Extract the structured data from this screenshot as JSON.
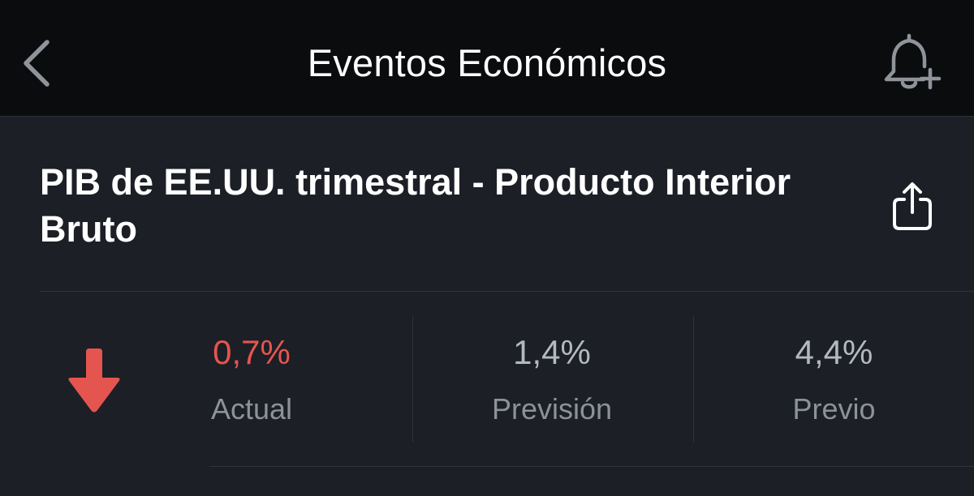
{
  "colors": {
    "nav_background": "#0b0c0e",
    "page_background": "#1c1f26",
    "negative": "#e5554f",
    "text_primary": "#ffffff",
    "text_secondary": "#8d9199"
  },
  "nav": {
    "back_icon": "chevron-left-icon",
    "title": "Eventos Económicos",
    "alert_icon": "bell-plus-icon"
  },
  "event": {
    "title": "PIB de EE.UU. trimestral - Producto Interior Bruto",
    "share_icon": "share-icon",
    "trend_icon": "arrow-down-icon",
    "trend": "down"
  },
  "stats": {
    "actual": {
      "value": "0,7%",
      "label": "Actual"
    },
    "forecast": {
      "value": "1,4%",
      "label": "Previsión"
    },
    "previous": {
      "value": "4,4%",
      "label": "Previo"
    }
  }
}
